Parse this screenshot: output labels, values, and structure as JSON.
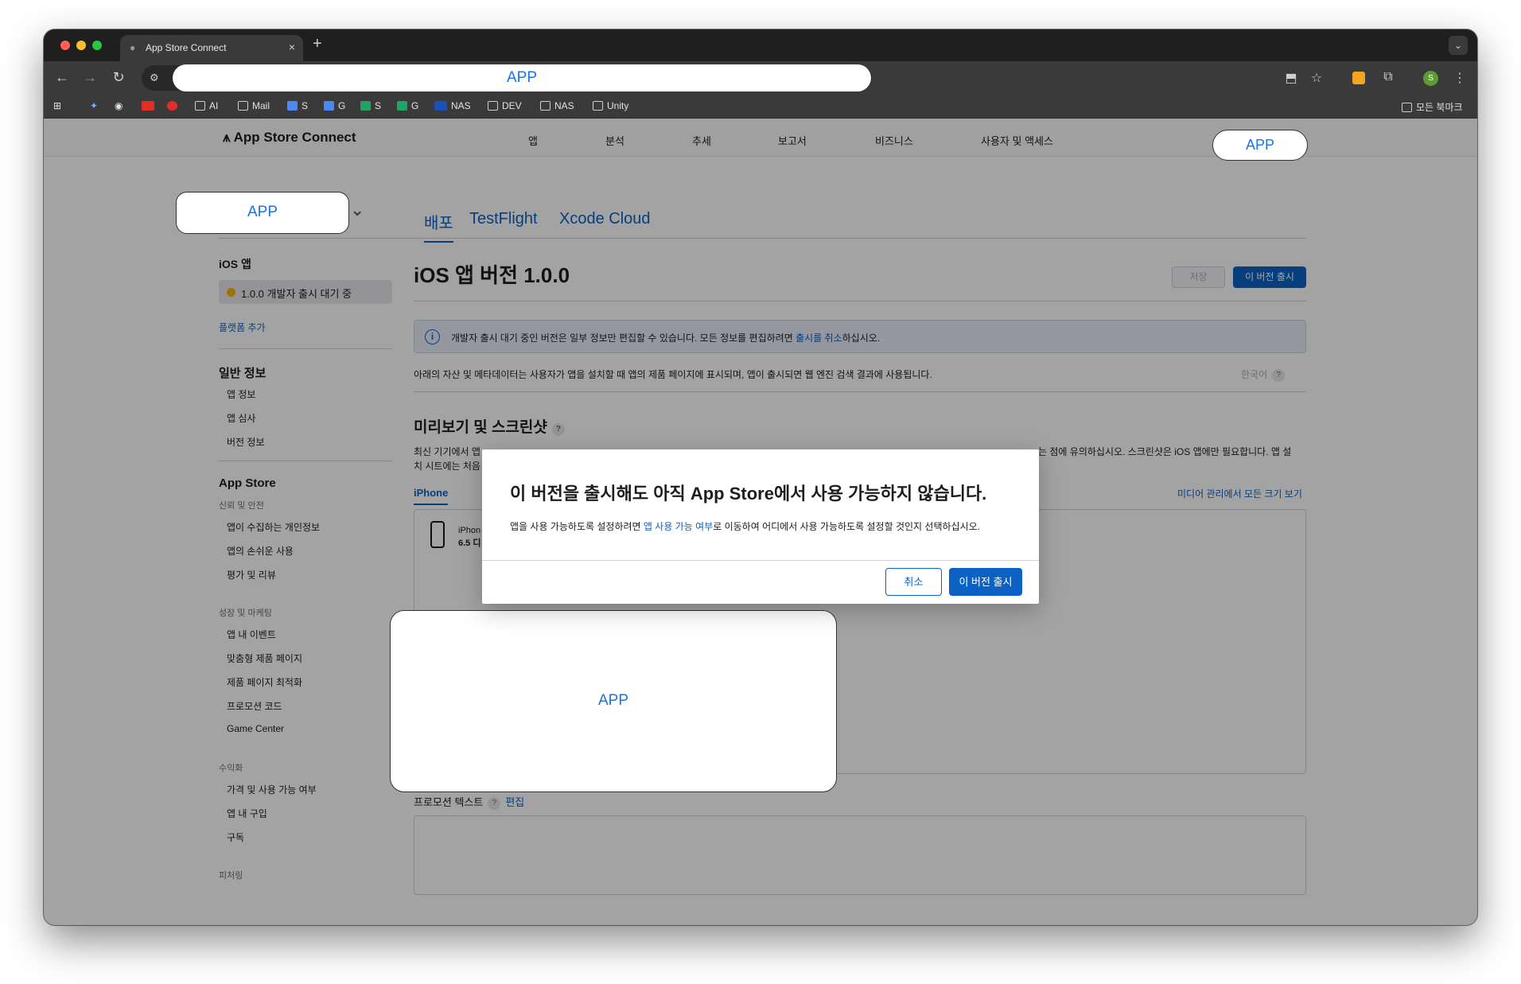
{
  "browser": {
    "tab_title": "App Store Connect",
    "new_tab": "+",
    "tab_close": "×",
    "address_placeholder_label": "APP",
    "profile_initial": "S",
    "bookmarks": [
      {
        "label": "AI",
        "icon": "folder-icon"
      },
      {
        "label": "Mail",
        "icon": "folder-icon"
      },
      {
        "label": "S",
        "icon": "google-docs-icon"
      },
      {
        "label": "G",
        "icon": "google-docs-icon"
      },
      {
        "label": "S",
        "icon": "google-sheets-icon"
      },
      {
        "label": "G",
        "icon": "google-sheets-icon"
      },
      {
        "label": "NAS",
        "icon": "dsm-icon"
      },
      {
        "label": "DEV",
        "icon": "folder-icon"
      },
      {
        "label": "NAS",
        "icon": "folder-icon"
      },
      {
        "label": "Unity",
        "icon": "folder-icon"
      }
    ],
    "all_bookmarks": "모든 북마크"
  },
  "asc": {
    "logo": "App Store Connect",
    "menu": [
      "앱",
      "분석",
      "추세",
      "보고서",
      "비즈니스",
      "사용자 및 액세스"
    ],
    "account_pill": "APP",
    "app_selector": "APP",
    "tabs": [
      "배포",
      "TestFlight",
      "Xcode Cloud"
    ]
  },
  "sidebar": {
    "ios_app": "iOS 앱",
    "status": "1.0.0 개발자 출시 대기 중",
    "add_platform": "플랫폼 추가",
    "general_head": "일반 정보",
    "general_items": [
      "앱 정보",
      "앱 심사",
      "버전 정보"
    ],
    "appstore_head": "App Store",
    "trust_group": "신뢰 및 안전",
    "trust_items": [
      "앱이 수집하는 개인정보",
      "앱의 손쉬운 사용",
      "평가 및 리뷰"
    ],
    "growth_group": "성장 및 마케팅",
    "growth_items": [
      "앱 내 이벤트",
      "맞춤형 제품 페이지",
      "제품 페이지 최적화",
      "프로모션 코드",
      "Game Center"
    ],
    "monetize_group": "수익화",
    "monetize_items": [
      "가격 및 사용 가능 여부",
      "앱 내 구입",
      "구독"
    ],
    "featuring_group": "피처링"
  },
  "main": {
    "title": "iOS 앱 버전 1.0.0",
    "save": "저장",
    "release": "이 버전 출시",
    "banner_text": "개발자 출시 대기 중인 버전은 일부 정보만 편집할 수 있습니다. 모든 정보를 편집하려면 ",
    "banner_link": "출시를 취소",
    "banner_suffix": "하십시오.",
    "description": "아래의 자산 및 메타데이터는 사용자가 앱을 설치할 때 앱의 제품 페이지에 표시되며, 앱이 출시되면 웹 엔진 검색 결과에 사용됩니다.",
    "language": "한국어",
    "section_title": "미리보기 및 스크린샷",
    "section_desc_1_start": "최신 기기에서 앱",
    "section_desc_1_end": "는 점에 유의하십시오. 스크린샷은 iOS 앱에만 필요합니다. 앱 설",
    "section_desc_2": "치 시트에는 처음",
    "iphone_tab": "iPhone",
    "media_link": "미디어 관리에서 모든 크기 보기",
    "device_name": "iPhon",
    "device_size": "6.5 디",
    "app_card": "APP",
    "promo_label": "프로모션 텍스트",
    "promo_help": "?",
    "promo_edit": "편집"
  },
  "modal": {
    "title": "이 버전을 출시해도 아직 App Store에서 사용 가능하지 않습니다.",
    "body_start": "앱을 사용 가능하도록 설정하려면 ",
    "body_link": "앱 사용 가능 여부",
    "body_end": "로 이동하여 어디에서 사용 가능하도록 설정할 것인지 선택하십시오.",
    "cancel": "취소",
    "confirm": "이 버전 출시"
  }
}
